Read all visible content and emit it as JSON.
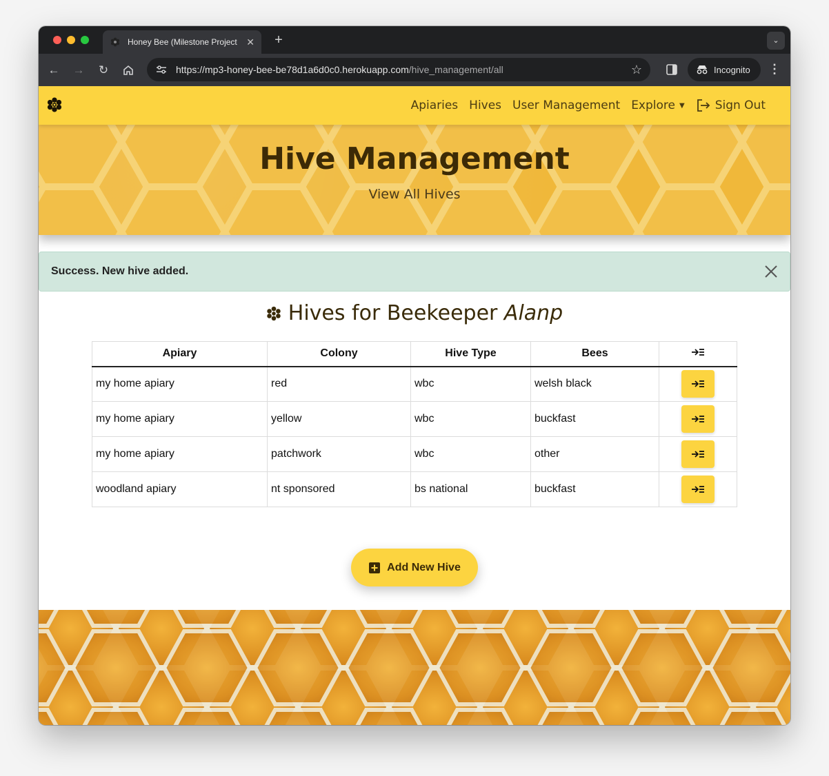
{
  "browser": {
    "tab_title": "Honey Bee (Milestone Project",
    "url_main": "https://mp3-honey-bee-be78d1a6d0c0.herokuapp.com",
    "url_path": "/hive_management/all",
    "incognito_label": "Incognito"
  },
  "nav": {
    "links": [
      "Apiaries",
      "Hives",
      "User Management",
      "Explore"
    ],
    "sign_out": "Sign Out"
  },
  "hero": {
    "title": "Hive Management",
    "subtitle": "View All Hives"
  },
  "alert": {
    "message": "Success. New hive added."
  },
  "heading": {
    "prefix": "Hives for Beekeeper",
    "user": "Alanp"
  },
  "table": {
    "columns": [
      "Apiary",
      "Colony",
      "Hive Type",
      "Bees"
    ],
    "rows": [
      [
        "my home apiary",
        "red",
        "wbc",
        "welsh black"
      ],
      [
        "my home apiary",
        "yellow",
        "wbc",
        "buckfast"
      ],
      [
        "my home apiary",
        "patchwork",
        "wbc",
        "other"
      ],
      [
        "woodland apiary",
        "nt sponsored",
        "bs national",
        "buckfast"
      ]
    ]
  },
  "add_button": "Add New Hive",
  "colors": {
    "brand_yellow": "#fcd440",
    "dark_brown": "#3c2a06",
    "alert_bg": "#d1e7dd"
  }
}
